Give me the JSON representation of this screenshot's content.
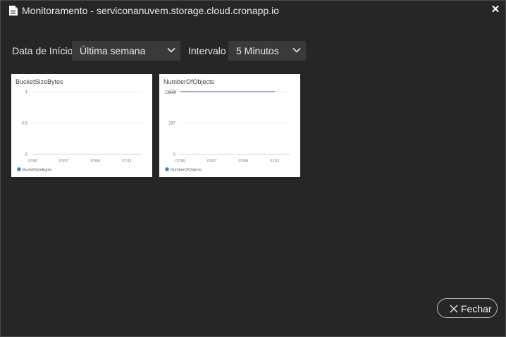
{
  "window": {
    "title": "Monitoramento - serviconanuvem.storage.cloud.cronapp.io",
    "close_glyph": "✕"
  },
  "filters": {
    "start_label": "Data de Início",
    "start_value": "Última semana",
    "interval_label": "Intervalo",
    "interval_value": "5 Minutos"
  },
  "footer": {
    "close_label": "Fechar"
  },
  "colors": {
    "background": "#262626",
    "series": "#4a80c2",
    "card": "#ffffff"
  },
  "chart_data": [
    {
      "type": "line",
      "title": "BucketSizeBytes",
      "ylabel": "",
      "x_ticks": [
        "07/05",
        "07/07",
        "07/09",
        "07/11"
      ],
      "y_ticks": [
        "1",
        "0.5",
        "0"
      ],
      "ylim": [
        0,
        1
      ],
      "series": [
        {
          "name": "BucketSizeBytes",
          "x": [],
          "y": []
        }
      ],
      "legend": "bottom-left",
      "grid": true
    },
    {
      "type": "line",
      "title": "NumberOfObjects",
      "ylabel": "Count",
      "x_ticks": [
        "07/05",
        "07/07",
        "07/09",
        "07/11"
      ],
      "y_ticks": [
        "673",
        "337",
        "0"
      ],
      "ylim": [
        0,
        673
      ],
      "series": [
        {
          "name": "NumberOfObjects",
          "x": [
            "07/05",
            "07/11"
          ],
          "y": [
            673,
            673
          ]
        }
      ],
      "legend": "bottom-left",
      "grid": true
    }
  ]
}
